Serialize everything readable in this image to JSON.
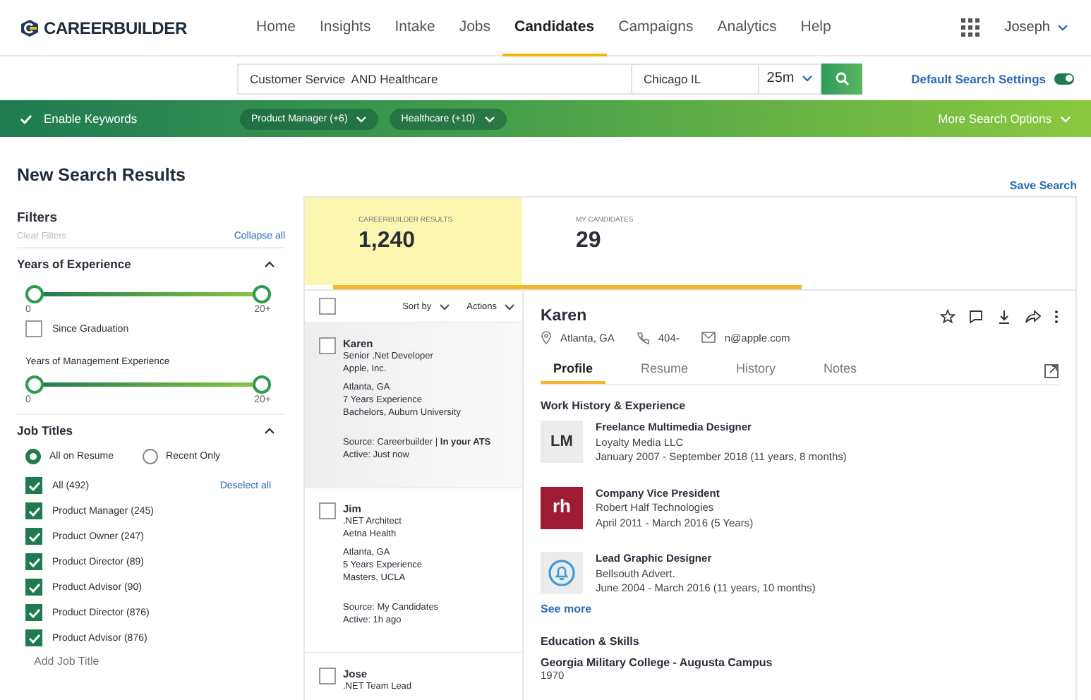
{
  "nav": {
    "brand": "CAREERBUILDER",
    "items": [
      {
        "label": "Home",
        "selected": false
      },
      {
        "label": "Insights",
        "selected": false
      },
      {
        "label": "Intake",
        "selected": false
      },
      {
        "label": "Jobs",
        "selected": false
      },
      {
        "label": "Candidates",
        "selected": true
      },
      {
        "label": "Campaigns",
        "selected": false
      },
      {
        "label": "Analytics",
        "selected": false
      },
      {
        "label": "Help",
        "selected": false
      }
    ],
    "user": "Joseph"
  },
  "search": {
    "keywords": "Customer Service  AND Healthcare",
    "location": "Chicago IL",
    "radius": "25m",
    "settings_label": "Default Search Settings",
    "settings_on": true
  },
  "keyword_bar": {
    "enable_label": "Enable Keywords",
    "enabled": true,
    "chips": [
      "Product Manager (+6)",
      "Healthcare (+10)"
    ],
    "more": "More Search Options"
  },
  "page_title": "New Search Results",
  "save_search": "Save Search",
  "filters": {
    "title": "Filters",
    "clear": "Clear Filters",
    "collapse": "Collapse all",
    "experience": {
      "title": "Years of Experience",
      "expanded": true,
      "slider": {
        "level": 1,
        "min": "0",
        "max": "20+"
      },
      "since_graduation": {
        "label": "Since Graduation",
        "checked": false
      },
      "management_label": "Years of Management Experience",
      "management_slider": {
        "level": 1,
        "min": "0",
        "max": "20+"
      }
    },
    "job_titles": {
      "title": "Job Titles",
      "expanded": true,
      "modes": [
        {
          "label": "All on Resume",
          "selected": true
        },
        {
          "label": "Recent Only",
          "selected": false
        }
      ],
      "deselect": "Deselect all",
      "options": [
        {
          "label": "All (492)",
          "checked": true
        },
        {
          "label": "Product Manager (245)",
          "checked": true
        },
        {
          "label": "Product Owner (247)",
          "checked": true
        },
        {
          "label": "Product Director (89)",
          "checked": true
        },
        {
          "label": "Product Advisor (90)",
          "checked": true
        },
        {
          "label": "Product Director (876)",
          "checked": true
        },
        {
          "label": "Product Advisor (876)",
          "checked": true
        }
      ],
      "add": "Add Job Title"
    }
  },
  "result_tabs": [
    {
      "label": "CAREERBUILDER RESULTS",
      "count": "1,240",
      "selected": true
    },
    {
      "label": "MY CANDIDATES",
      "count": "29",
      "selected": false
    }
  ],
  "list_toolbar": {
    "select_all": false,
    "sort": "Sort by",
    "actions": "Actions"
  },
  "candidates": [
    {
      "name": "Karen",
      "title": "Senior .Net Developer",
      "company": "Apple, Inc.",
      "details": [
        "Atlanta, GA",
        "7 Years Experience",
        "Bachelors, Auburn University"
      ],
      "source": "Source: Careerbuilder  |  **In your ATS**",
      "active": "Active: Just now",
      "checked": false,
      "selected": true
    },
    {
      "name": "Jim",
      "title": ".NET Architect",
      "company": "Aetna Health",
      "details": [
        "Atlanta, GA",
        "5 Years Experience",
        "Masters, UCLA"
      ],
      "source": "Source: My Candidates",
      "active": "Active: 1h ago",
      "checked": false,
      "selected": false
    },
    {
      "name": "Jose",
      "title": ".NET Team Lead",
      "checked": false,
      "selected": false
    }
  ],
  "profile": {
    "name": "Karen",
    "location": "Atlanta, GA",
    "phone": "404-",
    "email": "n@apple.com",
    "tabs": [
      {
        "label": "Profile",
        "selected": true
      },
      {
        "label": "Resume",
        "selected": false
      },
      {
        "label": "History",
        "selected": false
      },
      {
        "label": "Notes",
        "selected": false
      }
    ],
    "work_title": "Work History & Experience",
    "jobs": [
      {
        "kind": "initials",
        "logo": "LM",
        "title": "Freelance Multimedia Designer",
        "company": "Loyalty Media LLC",
        "dates": "January 2007 - September 2018 (11 years, 8 months)"
      },
      {
        "kind": "wordmark",
        "logo": "rh",
        "title": "Company Vice President",
        "company": "Robert Half Technologies",
        "dates": "April 2011 - March 2016 (5 Years)"
      },
      {
        "kind": "bell",
        "title": "Lead Graphic Designer",
        "company": "Bellsouth Advert.",
        "dates": "June 2004 - March 2016 (11 years, 10 months)"
      }
    ],
    "see_more": "See more",
    "education_title": "Education & Skills",
    "school": "Georgia Military College - Augusta Campus",
    "year": "1970"
  }
}
